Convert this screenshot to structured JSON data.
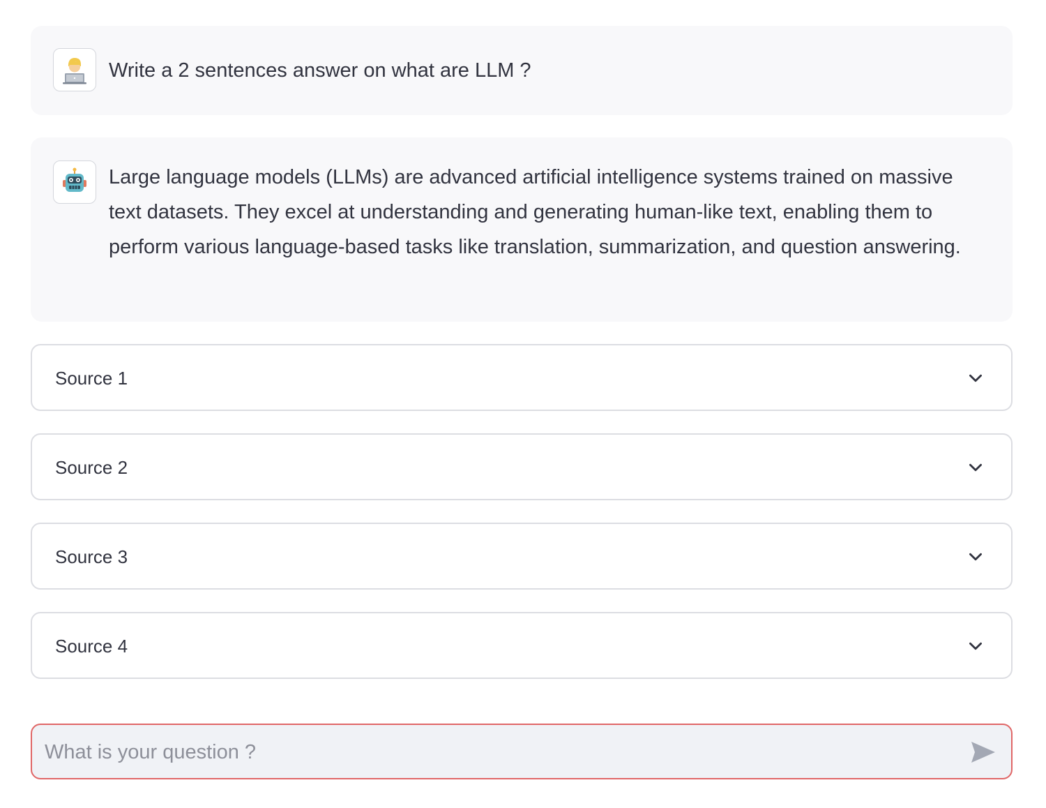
{
  "chat": {
    "messages": [
      {
        "role": "user",
        "avatar_icon": "technologist-emoji-icon",
        "text": "Write a 2 sentences answer on what are LLM ?"
      },
      {
        "role": "assistant",
        "avatar_icon": "robot-emoji-icon",
        "text": "Large language models (LLMs) are advanced artificial intelligence systems trained on massive text datasets. They excel at understanding and generating human-like text, enabling them to perform various language-based tasks like translation, summarization, and question answering."
      }
    ],
    "sources": [
      {
        "label": "Source 1",
        "icon": "chevron-down-icon"
      },
      {
        "label": "Source 2",
        "icon": "chevron-down-icon"
      },
      {
        "label": "Source 3",
        "icon": "chevron-down-icon"
      },
      {
        "label": "Source 4",
        "icon": "chevron-down-icon"
      }
    ],
    "input": {
      "placeholder": "What is your question ?",
      "value": "",
      "send_icon": "send-icon"
    }
  },
  "colors": {
    "message_bg": "#f8f8fa",
    "text": "#31333f",
    "border": "#dcdde2",
    "input_border_focus": "#e06666",
    "input_bg": "#f0f2f6",
    "placeholder": "#8d8f99",
    "send_icon": "#a3a8b4"
  }
}
